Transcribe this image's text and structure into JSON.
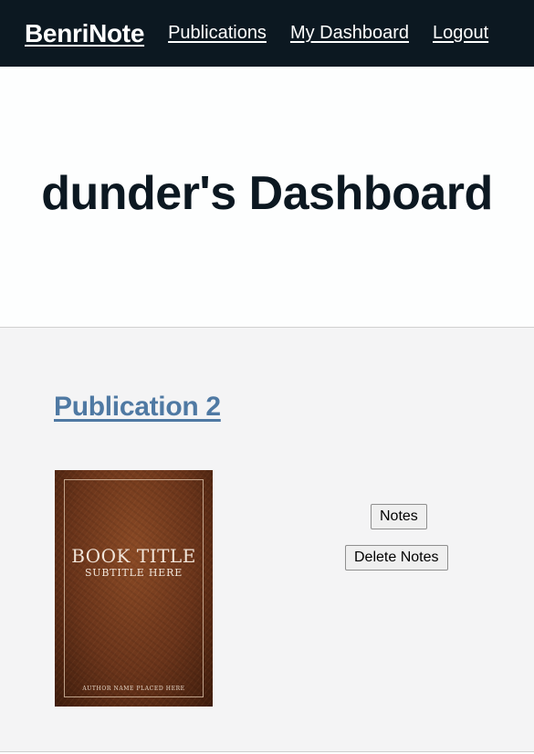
{
  "nav": {
    "brand": "BenriNote",
    "links": [
      "Publications",
      "My Dashboard",
      "Logout"
    ]
  },
  "hero": {
    "title": "dunder's Dashboard"
  },
  "publication": {
    "title": "Publication 2",
    "cover": {
      "title": "BOOK TITLE",
      "subtitle": "SUBTITLE HERE",
      "author": "AUTHOR NAME PLACED HERE"
    },
    "notes_button": "Notes",
    "delete_button": "Delete Notes"
  },
  "colors": {
    "navbar": "#0c1821",
    "link_accent": "#4f79a3",
    "section_bg": "#f4f4f5"
  }
}
